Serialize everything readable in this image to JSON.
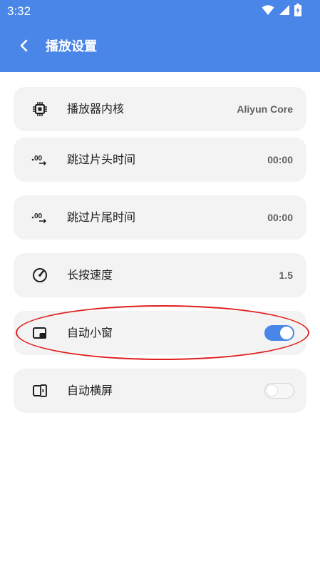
{
  "status_bar": {
    "time": "3:32",
    "icons": [
      "wifi-icon",
      "signal-icon",
      "battery-charging-icon"
    ]
  },
  "toolbar": {
    "back_icon": "chevron-left-icon",
    "title": "播放设置"
  },
  "colors": {
    "appbar": "#4a86e8",
    "card_background": "#f3f3f3",
    "highlight": "#e01e1e"
  },
  "settings": [
    {
      "icon": "chip-icon",
      "label": "播放器内核",
      "value": "Aliyun Core"
    },
    {
      "icon": "skip-time-icon",
      "label": "跳过片头时间",
      "value": "00:00"
    },
    {
      "icon": "skip-time-icon",
      "label": "跳过片尾时间",
      "value": "00:00"
    },
    {
      "icon": "speedometer-icon",
      "label": "长按速度",
      "value": "1.5"
    },
    {
      "icon": "picture-in-picture-icon",
      "label": "自动小窗",
      "toggle": true
    },
    {
      "icon": "screen-rotate-icon",
      "label": "自动横屏",
      "toggle": false
    }
  ]
}
